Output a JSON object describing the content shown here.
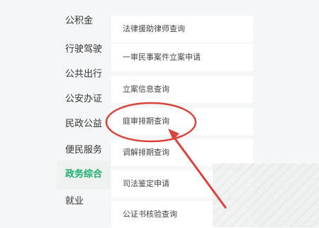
{
  "sidebar": {
    "categories": [
      {
        "label": "公积金"
      },
      {
        "label": "行驶驾驶"
      },
      {
        "label": "公共出行"
      },
      {
        "label": "公安办证"
      },
      {
        "label": "民政公益"
      },
      {
        "label": "便民服务"
      },
      {
        "label": "政务综合"
      },
      {
        "label": "就业"
      }
    ],
    "active_index": 6
  },
  "services": {
    "items": [
      {
        "label": "法律援助律师查询"
      },
      {
        "label": "一审民事案件立案申请"
      },
      {
        "label": "立案信息查询"
      },
      {
        "label": "庭审排期查询"
      },
      {
        "label": "调解排期查询"
      },
      {
        "label": "司法鉴定申请"
      },
      {
        "label": "公证书核验查询"
      }
    ],
    "highlighted_index": 3
  },
  "colors": {
    "accent": "#1aad6e",
    "annotation": "#d9443c"
  }
}
